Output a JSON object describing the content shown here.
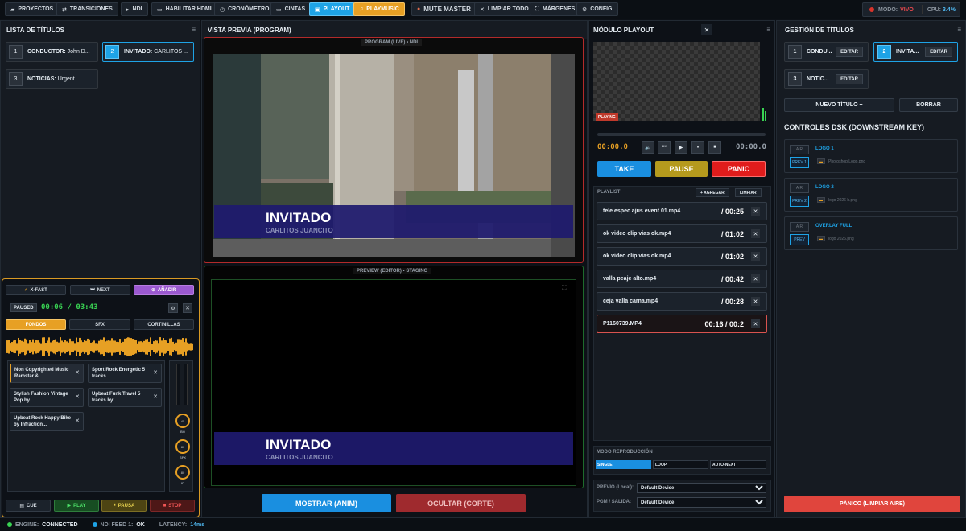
{
  "topbar": {
    "buttons": [
      {
        "icon": "▰",
        "label": "PROYECTOS"
      },
      {
        "icon": "⇄",
        "label": "TRANSICIONES"
      },
      {
        "icon": "▸",
        "label": "NDI"
      },
      {
        "icon": "▭",
        "label": "HABILITAR HDMI"
      },
      {
        "icon": "◷",
        "label": "CRONÓMETRO"
      },
      {
        "icon": "▭",
        "label": "CINTAS"
      },
      {
        "icon": "▣",
        "label": "PLAYOUT"
      },
      {
        "icon": "♫",
        "label": "PLAYMUSIC"
      },
      {
        "icon": "●",
        "label": "MUTE MASTER"
      },
      {
        "icon": "✕",
        "label": "LIMPIAR TODO"
      },
      {
        "icon": "⛶",
        "label": "MÁRGENES"
      },
      {
        "icon": "⚙",
        "label": "CONFIG"
      }
    ],
    "modo_label": "MODO:",
    "modo_value": "VIVO",
    "cpu_label": "CPU:",
    "cpu_value": "3.4%"
  },
  "lista": {
    "title": "LISTA DE TÍTULOS",
    "items": [
      {
        "num": "1",
        "label": "CONDUCTOR:",
        "value": "John D..."
      },
      {
        "num": "2",
        "label": "INVITADO:",
        "value": "CARLITOS ..."
      },
      {
        "num": "3",
        "label": "NOTICIAS:",
        "value": "Urgent"
      }
    ]
  },
  "music": {
    "xfast": "X-FAST",
    "next": "NEXT",
    "add": "AÑADIR",
    "state": "PAUSED",
    "time": "00:06 / 03:43",
    "tabs": [
      "FONDOS",
      "SFX",
      "CORTINILLAS"
    ],
    "tracks": [
      "Non Copyrighted Music Ramstar &...",
      "Sport Rock Energetic 5 tracks...",
      "Stylish Fashion Vintage Pop by...",
      "Upbeat Funk Travel 5 tracks by...",
      "Upbeat Rock Happy Bike by Infraction..."
    ],
    "knobs": [
      {
        "value": "45",
        "label": "BG"
      },
      {
        "value": "80",
        "label": "SFX"
      },
      {
        "value": "80",
        "label": "ID"
      }
    ],
    "cue": "CUE",
    "play": "PLAY",
    "pause": "PAUSA",
    "stop": "STOP"
  },
  "preview": {
    "title": "VISTA PREVIA (PROGRAM)",
    "program_label": "PROGRAM (LIVE) • NDI",
    "preview_label": "PREVIEW (EDITOR) • STAGING",
    "lt_title": "INVITADO",
    "lt_sub": "CARLITOS JUANCITO",
    "show_btn": "MOSTRAR (ANIM)",
    "hide_btn": "OCULTAR (CORTE)"
  },
  "playout": {
    "title": "MÓDULO PLAYOUT",
    "playing": "PLAYING",
    "time_left": "00:00.0",
    "time_right": "00:00.0",
    "take": "TAKE",
    "pause": "PAUSE",
    "panic": "PANIC",
    "playlist_label": "PLAYLIST",
    "add": "+ AGREGAR",
    "clear": "LIMPIAR",
    "items": [
      {
        "name": "tele espec ajus event 01.mp4",
        "dur": "/ 00:25"
      },
      {
        "name": "ok video clip vias ok.mp4",
        "dur": "/ 01:02"
      },
      {
        "name": "ok video clip vias ok.mp4",
        "dur": "/ 01:02"
      },
      {
        "name": "valla peaje alto.mp4",
        "dur": "/ 00:42"
      },
      {
        "name": "ceja valla carna.mp4",
        "dur": "/ 00:28"
      },
      {
        "name": "P1160739.MP4",
        "dur": "00:16  / 00:2"
      }
    ],
    "modo_label": "MODO REPRODUCCIÓN",
    "modes": [
      "SINGLE",
      "LOOP",
      "AUTO-NEXT"
    ],
    "previo_label": "PREVIO (Local):",
    "pgm_label": "PGM / SALIDA:",
    "device": "Default Device"
  },
  "gestion": {
    "title": "GESTIÓN DE TÍTULOS",
    "cards": [
      {
        "num": "1",
        "label": "CONDU...",
        "edit": "EDITAR"
      },
      {
        "num": "2",
        "label": "INVITA...",
        "edit": "EDITAR"
      },
      {
        "num": "3",
        "label": "NOTIC...",
        "edit": "EDITAR"
      }
    ],
    "new_btn": "NUEVO TÍTULO +",
    "clear_btn": "BORRAR",
    "dsk_title": "CONTROLES DSK (DOWNSTREAM KEY)",
    "dsk": [
      {
        "air": "AIR",
        "prev": "PREV 1",
        "name": "LOGO 1",
        "file": "Photoshop Logo.png"
      },
      {
        "air": "AIR",
        "prev": "PREV 2",
        "name": "LOGO 2",
        "file": "logo 2026 b.png"
      },
      {
        "air": "AIR",
        "prev": "PREV",
        "name": "OVERLAY FULL",
        "file": "logo 2026.png"
      }
    ],
    "panic_btn": "PÁNICO (LIMPIAR AIRE)"
  },
  "status": {
    "engine_label": "ENGINE:",
    "engine_value": "CONNECTED",
    "ndi_label": "NDI FEED 1:",
    "ndi_value": "OK",
    "latency_label": "LATENCY:",
    "latency_value": "14ms"
  }
}
